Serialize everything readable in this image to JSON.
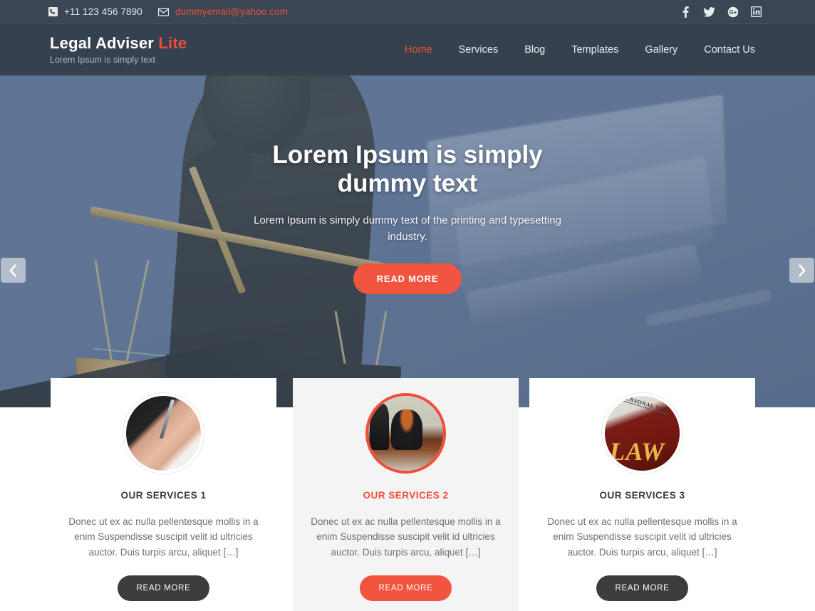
{
  "topbar": {
    "phone_icon": "phone-icon",
    "phone": "+11 123 456 7890",
    "email_icon": "envelope-icon",
    "email": "dummyemail@yahoo.com",
    "socials": [
      {
        "name": "facebook-icon",
        "glyph": "f"
      },
      {
        "name": "twitter-icon",
        "glyph": "t"
      },
      {
        "name": "google-plus-icon",
        "glyph": "G+"
      },
      {
        "name": "linkedin-icon",
        "glyph": "in"
      }
    ]
  },
  "header": {
    "brand_main": "Legal Adviser",
    "brand_accent": "Lite",
    "tagline": "Lorem Ipsum is simply text",
    "nav": [
      {
        "label": "Home",
        "active": true
      },
      {
        "label": "Services",
        "active": false
      },
      {
        "label": "Blog",
        "active": false
      },
      {
        "label": "Templates",
        "active": false
      },
      {
        "label": "Gallery",
        "active": false
      },
      {
        "label": "Contact Us",
        "active": false
      }
    ]
  },
  "hero": {
    "title": "Lorem Ipsum is simply dummy text",
    "subtitle": "Lorem Ipsum is simply dummy text of the printing and typesetting industry.",
    "button": "READ MORE",
    "prev_icon": "chevron-left-icon",
    "next_icon": "chevron-right-icon",
    "image_alt": "lady-justice-statue-with-scales"
  },
  "services": [
    {
      "title": "OUR SERVICES 1",
      "text": "Donec ut ex ac nulla pellentesque mollis in a enim Suspendisse suscipit velit id ultricies auctor. Duis turpis arcu, aliquet […]",
      "button": "READ MORE",
      "image_alt": "hand-signing-document",
      "active": false
    },
    {
      "title": "OUR SERVICES 2",
      "text": "Donec ut ex ac nulla pellentesque mollis in a enim Suspendisse suscipit velit id ultricies auctor. Duis turpis arcu, aliquet […]",
      "button": "READ MORE",
      "image_alt": "lawyers-at-desk",
      "active": true
    },
    {
      "title": "OUR SERVICES 3",
      "text": "Donec ut ex ac nulla pellentesque mollis in a enim Suspendisse suscipit velit id ultricies auctor. Duis turpis arcu, aliquet […]",
      "button": "READ MORE",
      "image_alt": "law-book-personal-injury",
      "active": false
    }
  ],
  "colors": {
    "accent": "#ef4d38",
    "button_accent": "#f1543f",
    "topbar_bg": "#3b4654",
    "header_bg": "#36414f",
    "dark_button": "#3f3d3b",
    "card_active_bg": "#f4f4f4"
  }
}
